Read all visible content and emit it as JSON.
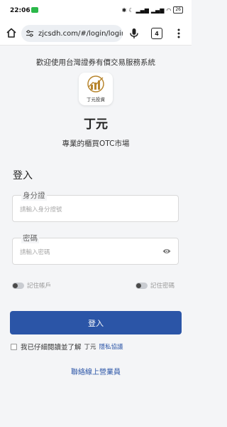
{
  "status_bar": {
    "time": "22:06",
    "battery": "26"
  },
  "browser": {
    "url": "zjcsdh.com/#/login/login",
    "tab_count": "4"
  },
  "page": {
    "welcome": "歡迎使用台灣證券有價交易服務系統",
    "logo_caption": "丁元投資",
    "brand_name": "丁元",
    "tagline": "專業的櫃買OTC市場",
    "login_heading": "登入",
    "id_label": "身分證",
    "id_placeholder": "請輸入身分證號",
    "password_label": "密碼",
    "password_placeholder": "請輸入密碼",
    "remember_account": "記住帳戶",
    "remember_password": "記住密碼",
    "login_button": "登入",
    "agree_text": "我已仔細閱讀並了解",
    "agree_brand": "丁元",
    "privacy_link": "隱私協議",
    "contact_link": "聯絡線上營業員"
  },
  "colors": {
    "primary": "#2b55a7",
    "background": "#f4f5f7",
    "logo_gold": "#b8862e"
  }
}
